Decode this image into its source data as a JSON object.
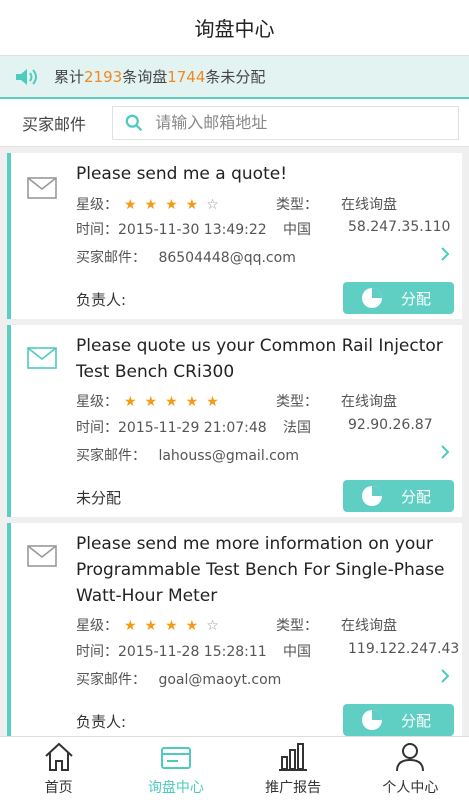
{
  "header": {
    "title": "询盘中心"
  },
  "notice": {
    "prefix": "累计",
    "total": "2193",
    "mid": "条询盘",
    "unassigned": "1744",
    "suffix": "条未分配"
  },
  "search": {
    "label": "买家邮件",
    "placeholder": "请输入邮箱地址"
  },
  "labels": {
    "stars": "星级：",
    "type": "类型：",
    "time_prefix": "时间：",
    "email": "买家邮件：",
    "assign": "分配"
  },
  "cards": [
    {
      "title": "Please send me a quote!",
      "rating": 4,
      "type": "在线询盘",
      "time": "2015-11-30 13:49:22",
      "country": "中国",
      "ip": "58.247.35.110",
      "email": "86504448@qq.com",
      "owner": "负责人:"
    },
    {
      "title": "Please quote us your Common Rail Injector Test Bench CRi300",
      "rating": 5,
      "type": "在线询盘",
      "time": "2015-11-29 21:07:48",
      "country": "法国",
      "ip": "92.90.26.87",
      "email": "lahouss@gmail.com",
      "owner": "未分配"
    },
    {
      "title": "Please send me more information on your Programmable Test Bench For Single-Phase Watt-Hour Meter",
      "rating": 4,
      "type": "在线询盘",
      "time": "2015-11-28 15:28:11",
      "country": "中国",
      "ip": "119.122.247.43",
      "email": "goal@maoyt.com",
      "owner": "负责人:"
    }
  ],
  "tabs": [
    {
      "label": "首页",
      "icon": "home-icon"
    },
    {
      "label": "询盘中心",
      "icon": "inquiry-icon",
      "active": true
    },
    {
      "label": "推广报告",
      "icon": "report-icon"
    },
    {
      "label": "个人中心",
      "icon": "user-icon"
    }
  ],
  "colors": {
    "accent": "#59cfc3",
    "star": "#f49b16",
    "number": "#f08a1f"
  }
}
